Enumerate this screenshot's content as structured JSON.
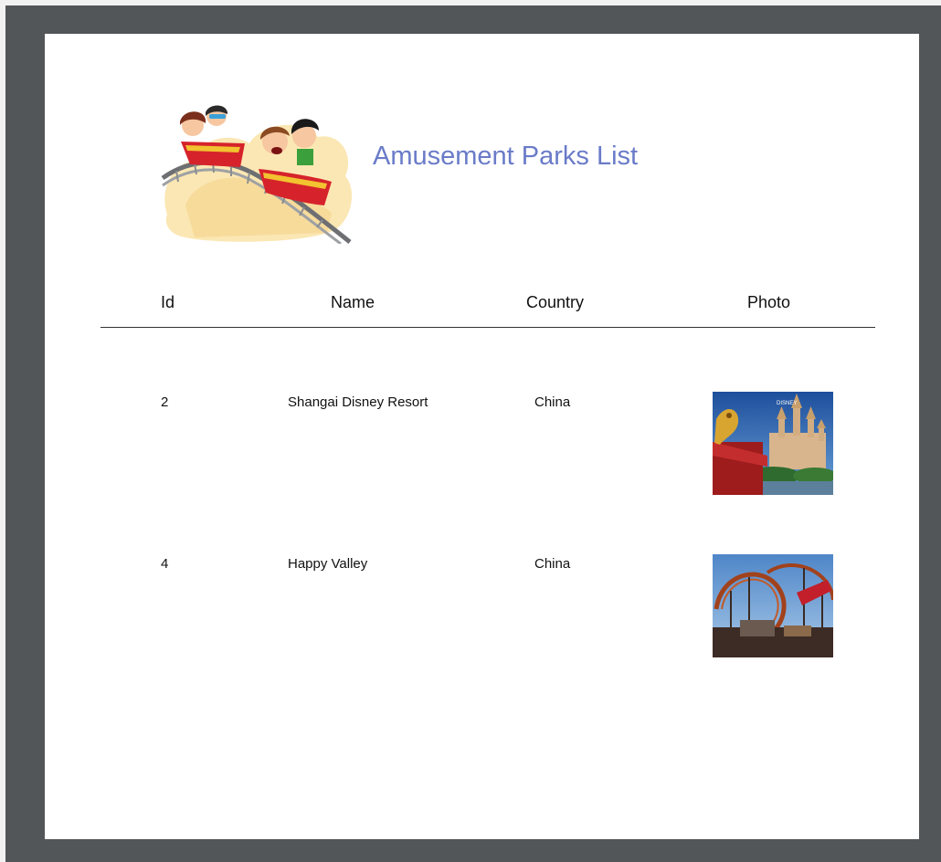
{
  "report": {
    "title": "Amusement Parks List"
  },
  "table": {
    "headers": [
      "Id",
      "Name",
      "Country",
      "Photo"
    ],
    "rows": [
      {
        "id": "2",
        "name": "Shangai Disney Resort",
        "country": "China",
        "photo": "disney-castle-photo"
      },
      {
        "id": "4",
        "name": "Happy Valley",
        "country": "China",
        "photo": "roller-coaster-photo"
      }
    ]
  },
  "logo": "roller-coaster-cartoon-logo",
  "colors": {
    "viewer_background": "#525659",
    "page_background": "#ffffff",
    "title": "#6a7bc8",
    "rule": "#333333"
  }
}
